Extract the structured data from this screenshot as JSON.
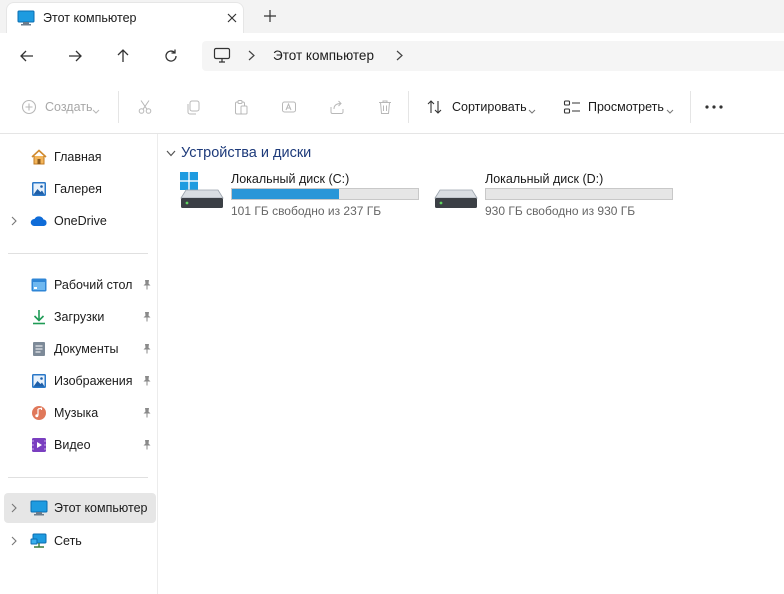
{
  "tab": {
    "title": "Этот компьютер"
  },
  "address": {
    "location": "Этот компьютер"
  },
  "toolbar": {
    "create_label": "Создать",
    "sort_label": "Сортировать",
    "view_label": "Просмотреть"
  },
  "nav": {
    "top": [
      {
        "label": "Главная",
        "icon": "home-icon"
      },
      {
        "label": "Галерея",
        "icon": "gallery-icon"
      },
      {
        "label": "OneDrive",
        "icon": "onedrive-icon"
      }
    ],
    "pinned": [
      {
        "label": "Рабочий стол",
        "icon": "desktop-icon"
      },
      {
        "label": "Загрузки",
        "icon": "downloads-icon"
      },
      {
        "label": "Документы",
        "icon": "documents-icon"
      },
      {
        "label": "Изображения",
        "icon": "pictures-icon"
      },
      {
        "label": "Музыка",
        "icon": "music-icon"
      },
      {
        "label": "Видео",
        "icon": "videos-icon"
      }
    ],
    "bottom": [
      {
        "label": "Этот компьютер",
        "icon": "this-pc-icon",
        "selected": true
      },
      {
        "label": "Сеть",
        "icon": "network-icon"
      }
    ]
  },
  "content": {
    "group_title": "Устройства и диски",
    "drives": [
      {
        "name": "Локальный диск (C:)",
        "free_text": "101 ГБ свободно из 237 ГБ",
        "used_fraction": 0.574
      },
      {
        "name": "Локальный диск (D:)",
        "free_text": "930 ГБ свободно из 930 ГБ",
        "used_fraction": 0.0
      }
    ]
  },
  "colors": {
    "accent": "#2996d8",
    "group_title": "#1d3a7a",
    "selected_bg": "#e6e6e6"
  }
}
